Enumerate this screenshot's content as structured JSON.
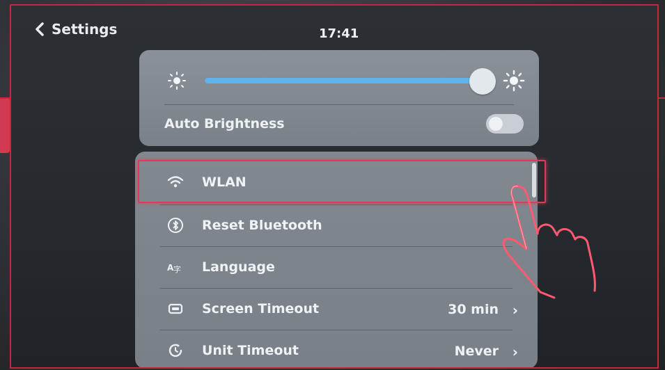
{
  "header": {
    "back_label": "Settings",
    "time": "17:41"
  },
  "brightness": {
    "level_percent": 96,
    "auto_label": "Auto Brightness",
    "auto_enabled": false
  },
  "list": {
    "items": [
      {
        "label": "WLAN",
        "value": "",
        "icon": "wifi-icon",
        "highlighted": true
      },
      {
        "label": "Reset Bluetooth",
        "value": "",
        "icon": "bluetooth-icon"
      },
      {
        "label": "Language",
        "value": "",
        "icon": "language-icon"
      },
      {
        "label": "Screen Timeout",
        "value": "30 min",
        "icon": "screen-icon"
      },
      {
        "label": "Unit Timeout",
        "value": "Never",
        "icon": "timer-icon"
      }
    ]
  },
  "colors": {
    "accent": "#5fb2ea",
    "highlight": "#e23a52",
    "card": "#7f858d"
  }
}
